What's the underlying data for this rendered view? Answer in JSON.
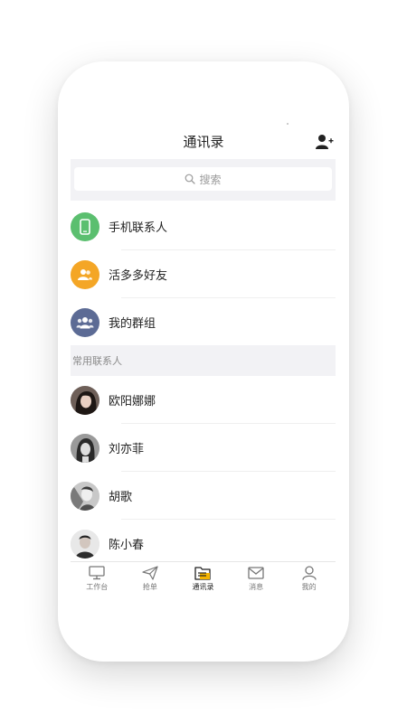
{
  "header": {
    "title": "通讯录",
    "add_icon": "add-contact-icon"
  },
  "search": {
    "placeholder": "搜索",
    "icon": "search-icon"
  },
  "menu": [
    {
      "label": "手机联系人",
      "icon": "phone-icon",
      "color": "#5bbf6f"
    },
    {
      "label": "活多多好友",
      "icon": "friends-icon",
      "color": "#f4a626"
    },
    {
      "label": "我的群组",
      "icon": "group-icon",
      "color": "#5c6b95"
    }
  ],
  "section": {
    "title": "常用联系人"
  },
  "contacts": [
    {
      "name": "欧阳娜娜"
    },
    {
      "name": "刘亦菲"
    },
    {
      "name": "胡歌"
    },
    {
      "name": "陈小春"
    }
  ],
  "tabs": [
    {
      "label": "工作台",
      "icon": "monitor-icon",
      "active": false
    },
    {
      "label": "抢单",
      "icon": "paper-plane-icon",
      "active": false
    },
    {
      "label": "通讯录",
      "icon": "contacts-folder-icon",
      "active": true
    },
    {
      "label": "消息",
      "icon": "mail-icon",
      "active": false
    },
    {
      "label": "我的",
      "icon": "user-icon",
      "active": false
    }
  ],
  "colors": {
    "accent_yellow": "#f4b400",
    "background_gray": "#f2f2f5"
  }
}
